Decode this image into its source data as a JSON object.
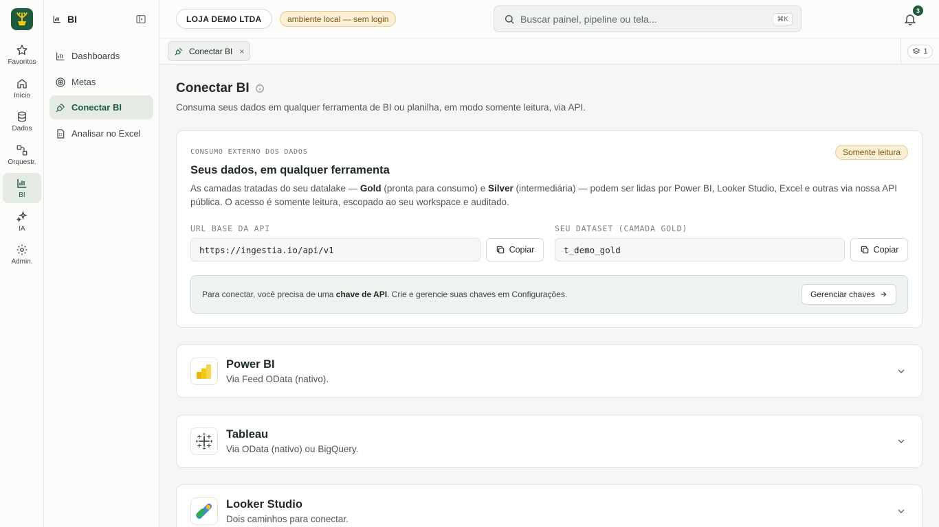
{
  "rail": {
    "items": [
      {
        "label": "Favoritos",
        "icon": "star-icon"
      },
      {
        "label": "Início",
        "icon": "home-icon"
      },
      {
        "label": "Dados",
        "icon": "database-icon"
      },
      {
        "label": "Orquestr.",
        "icon": "workflow-icon"
      },
      {
        "label": "BI",
        "icon": "bar-chart-icon",
        "active": true
      },
      {
        "label": "IA",
        "icon": "sparkles-icon"
      },
      {
        "label": "Admin.",
        "icon": "gear-icon"
      }
    ]
  },
  "sidebar": {
    "title": "BI",
    "items": [
      {
        "label": "Dashboards",
        "icon": "bar-chart-icon"
      },
      {
        "label": "Metas",
        "icon": "target-icon"
      },
      {
        "label": "Conectar BI",
        "icon": "plug-icon",
        "active": true
      },
      {
        "label": "Analisar no Excel",
        "icon": "spreadsheet-icon"
      }
    ]
  },
  "topbar": {
    "org": "LOJA DEMO LTDA",
    "env_badge": "ambiente local — sem login",
    "search_placeholder": "Buscar painel, pipeline ou tela...",
    "shortcut": "⌘K",
    "notifications": "3"
  },
  "tabs": {
    "open": [
      {
        "label": "Conectar BI",
        "close": "×"
      }
    ],
    "layers_count": "1"
  },
  "page": {
    "title": "Conectar BI",
    "subtitle": "Consuma seus dados em qualquer ferramenta de BI ou planilha, em modo somente leitura, via API."
  },
  "card": {
    "eyebrow": "CONSUMO EXTERNO DOS DADOS",
    "badge": "Somente leitura",
    "heading": "Seus dados, em qualquer ferramenta",
    "para_1": "As camadas tratadas do seu datalake — ",
    "para_gold": "Gold",
    "para_2": " (pronta para consumo) e ",
    "para_silver": "Silver",
    "para_3": " (intermediária) — podem ser lidas por Power BI, Looker Studio, Excel e outras via nossa API pública. O acesso é somente leitura, escopado ao seu workspace e auditado.",
    "api_label": "URL BASE DA API",
    "api_value": "https://ingestia.io/api/v1",
    "dataset_label": "SEU DATASET (CAMADA GOLD)",
    "dataset_value": "t_demo_gold",
    "copy_label": "Copiar",
    "notice_1": "Para conectar, você precisa de uma ",
    "notice_bold": "chave de API",
    "notice_2": ". Crie e gerencie suas chaves em Configurações.",
    "manage_label": "Gerenciar chaves"
  },
  "connectors": [
    {
      "name": "Power BI",
      "desc": "Via Feed OData (nativo).",
      "icon": "powerbi-logo-icon"
    },
    {
      "name": "Tableau",
      "desc": "Via OData (nativo) ou BigQuery.",
      "icon": "tableau-logo-icon"
    },
    {
      "name": "Looker Studio",
      "desc": "Dois caminhos para conectar.",
      "icon": "looker-logo-icon"
    }
  ],
  "colors": {
    "brand": "#1f5a3c",
    "badge_bg": "#fbf0d6",
    "badge_text": "#7a5410",
    "powerbi": "#f2c811"
  }
}
